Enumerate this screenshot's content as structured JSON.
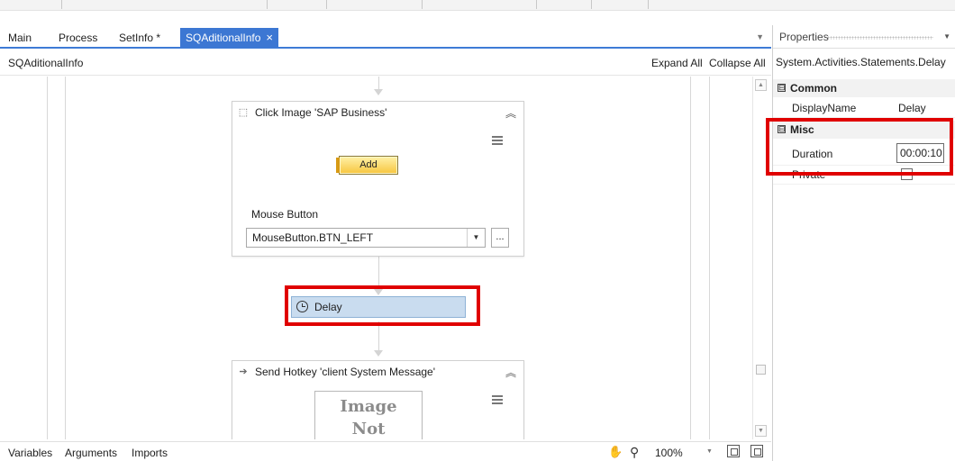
{
  "tabs": [
    {
      "label": "Main",
      "active": false
    },
    {
      "label": "Process",
      "active": false
    },
    {
      "label": "SetInfo *",
      "active": false
    },
    {
      "label": "SQAditionalInfo",
      "active": true,
      "close_glyph": "×"
    }
  ],
  "tab_dropdown_glyph": "▼",
  "designer": {
    "breadcrumb": "SQAditionalInfo",
    "expand_all": "Expand All",
    "collapse_all": "Collapse All"
  },
  "activities": {
    "click_image": {
      "title": "Click Image 'SAP Business'",
      "icon": "click-image-icon",
      "collapse_glyph": "⌃",
      "add_button_label": "Add",
      "mouse_button_label": "Mouse Button",
      "mouse_button_value": "MouseButton.BTN_LEFT",
      "dropdown_glyph": "▼",
      "ellipsis": "..."
    },
    "delay": {
      "label": "Delay",
      "icon": "clock-icon",
      "highlighted": true
    },
    "send_hotkey": {
      "title": "Send Hotkey 'client  System Message'",
      "icon": "send-hotkey-icon",
      "collapse_glyph": "⌃",
      "image_placeholder_line1": "Image",
      "image_placeholder_line2": "Not"
    }
  },
  "bottom_bar": {
    "variables": "Variables",
    "arguments": "Arguments",
    "imports": "Imports",
    "zoom": "100%",
    "icons": [
      "hand-pan-icon",
      "zoom-search-icon",
      "fit-to-screen-icon",
      "overview-icon"
    ]
  },
  "properties": {
    "title": "Properties",
    "type_name": "System.Activities.Statements.Delay",
    "categories": [
      {
        "name": "Common",
        "expander": "⊟",
        "rows": [
          {
            "key": "DisplayName",
            "value": "Delay"
          }
        ]
      },
      {
        "name": "Misc",
        "expander": "⊟",
        "rows": [
          {
            "key": "Duration",
            "value": "00:00:10"
          },
          {
            "key": "Private",
            "value": ""
          }
        ]
      }
    ]
  },
  "colors": {
    "active_tab": "#3c77d3",
    "highlight_red": "#e00000",
    "delay_fill": "#c9dcef",
    "add_button": "#f7c53d"
  }
}
